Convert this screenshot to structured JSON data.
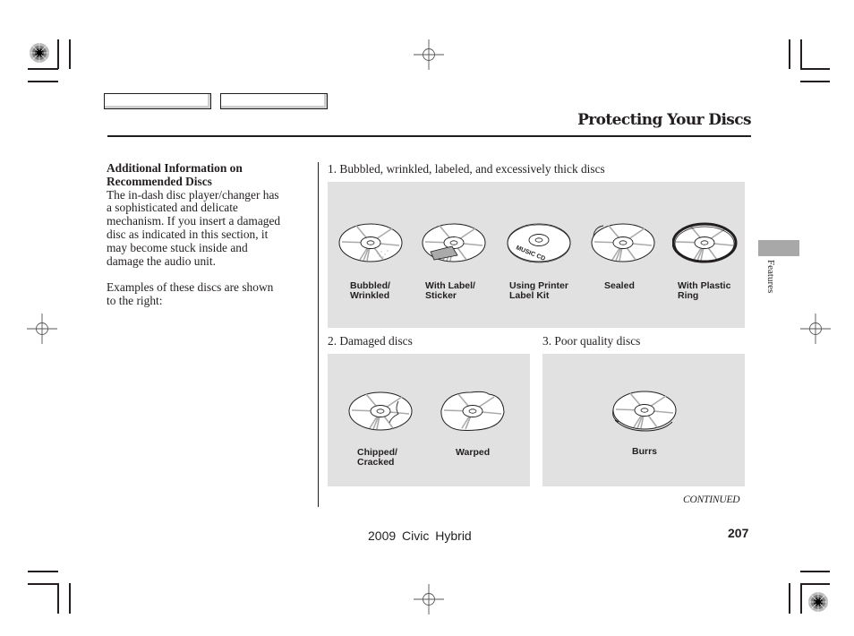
{
  "header": {
    "title": "Protecting Your Discs"
  },
  "sidebar_note": {
    "heading_line1": "Additional Information on",
    "heading_line2": "Recommended Discs",
    "body_lines": [
      "The in-dash disc player/changer has",
      "a sophisticated and delicate",
      "mechanism. If you insert a damaged",
      "disc as indicated in this section, it",
      "may become stuck inside and",
      "damage the audio unit."
    ],
    "examples_lines": [
      "Examples of these discs are shown",
      "to the right:"
    ]
  },
  "sections": [
    {
      "caption": "1. Bubbled, wrinkled, labeled, and excessively thick discs",
      "discs": [
        {
          "icon": "bubbled-disc-icon",
          "line1": "Bubbled/",
          "line2": "Wrinkled"
        },
        {
          "icon": "labeled-disc-icon",
          "line1": "With Label/",
          "line2": "Sticker"
        },
        {
          "icon": "printed-label-disc-icon",
          "line1": "Using Printer",
          "line2": "Label Kit",
          "printed_text": "MUSIC CD"
        },
        {
          "icon": "sealed-disc-icon",
          "line1": "Sealed",
          "line2": ""
        },
        {
          "icon": "ringed-disc-icon",
          "line1": "With Plastic",
          "line2": "Ring"
        }
      ]
    },
    {
      "caption": "2. Damaged discs",
      "discs": [
        {
          "icon": "chipped-disc-icon",
          "line1": "Chipped/",
          "line2": "Cracked"
        },
        {
          "icon": "warped-disc-icon",
          "line1": "Warped",
          "line2": ""
        }
      ]
    },
    {
      "caption": "3. Poor quality discs",
      "discs": [
        {
          "icon": "burred-disc-icon",
          "line1": "Burrs",
          "line2": ""
        }
      ]
    }
  ],
  "continued_label": "CONTINUED",
  "section_tab_label": "Features",
  "footer": {
    "model": "2009  Civic  Hybrid",
    "page_number": "207"
  },
  "colors": {
    "ink": "#231f20",
    "panel_bg": "#e1e1e1",
    "section_tab": "#a8a8a8"
  }
}
